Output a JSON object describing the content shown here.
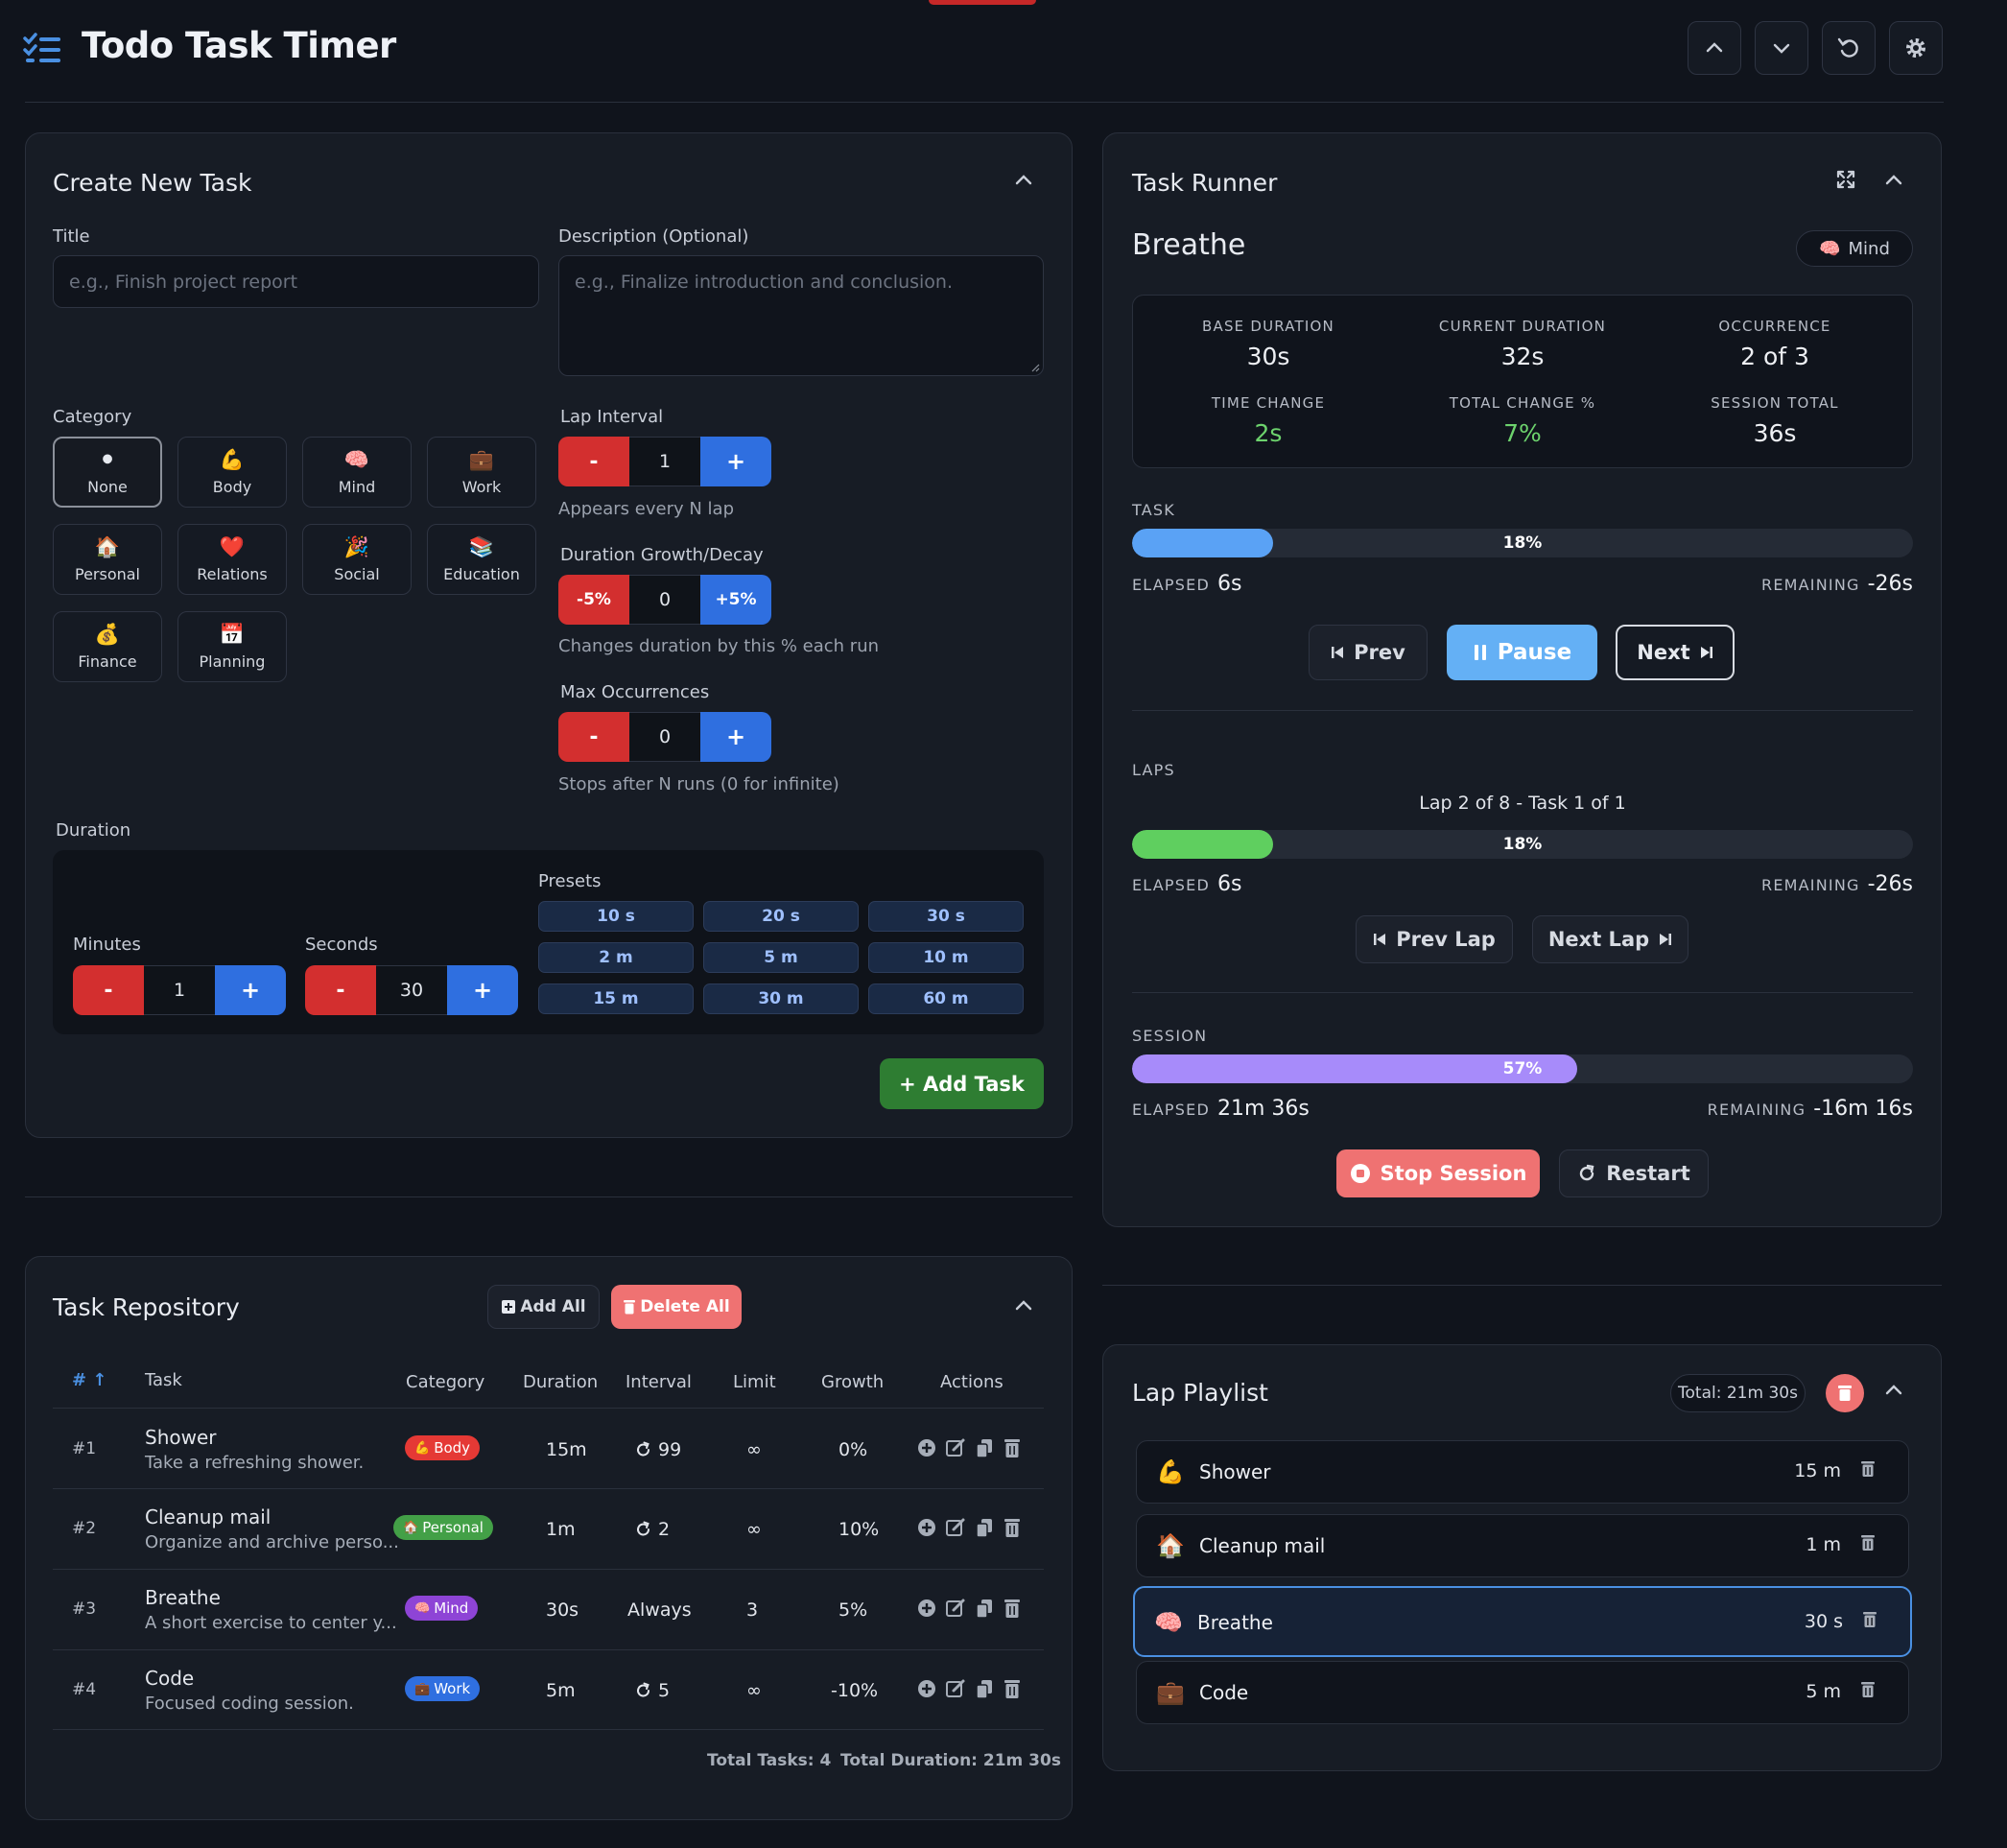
{
  "app": {
    "title": "Todo Task Timer"
  },
  "create": {
    "title": "Create New Task",
    "title_label": "Title",
    "title_placeholder": "e.g., Finish project report",
    "desc_label": "Description (Optional)",
    "desc_placeholder": "e.g., Finalize introduction and conclusion.",
    "category_label": "Category",
    "categories": [
      {
        "label": "None",
        "icon": "⚫"
      },
      {
        "label": "Body",
        "icon": "💪"
      },
      {
        "label": "Mind",
        "icon": "🧠"
      },
      {
        "label": "Work",
        "icon": "💼"
      },
      {
        "label": "Personal",
        "icon": "🏠"
      },
      {
        "label": "Relations",
        "icon": "❤️"
      },
      {
        "label": "Social",
        "icon": "🎉"
      },
      {
        "label": "Education",
        "icon": "📚"
      },
      {
        "label": "Finance",
        "icon": "💰"
      },
      {
        "label": "Planning",
        "icon": "📅"
      }
    ],
    "lap_interval": {
      "label": "Lap Interval",
      "minus": "-",
      "value": "1",
      "plus": "+",
      "hint": "Appears every N lap"
    },
    "growth": {
      "label": "Duration Growth/Decay",
      "minus": "-5%",
      "value": "0",
      "plus": "+5%",
      "hint": "Changes duration by this % each run"
    },
    "max_occ": {
      "label": "Max Occurrences",
      "minus": "-",
      "value": "0",
      "plus": "+",
      "hint": "Stops after N runs (0 for infinite)"
    },
    "duration_label": "Duration",
    "minutes": {
      "label": "Minutes",
      "minus": "-",
      "value": "1",
      "plus": "+"
    },
    "seconds": {
      "label": "Seconds",
      "minus": "-",
      "value": "30",
      "plus": "+"
    },
    "presets_label": "Presets",
    "presets": [
      "10 s",
      "20 s",
      "30 s",
      "2 m",
      "5 m",
      "10 m",
      "15 m",
      "30 m",
      "60 m"
    ],
    "add_button": "+ Add Task"
  },
  "runner": {
    "title": "Task Runner",
    "task_name": "Breathe",
    "category_badge": "Mind",
    "category_icon": "🧠",
    "stats": [
      {
        "label": "BASE DURATION",
        "value": "30s"
      },
      {
        "label": "CURRENT DURATION",
        "value": "32s"
      },
      {
        "label": "OCCURRENCE",
        "value": "2 of 3"
      },
      {
        "label": "TIME CHANGE",
        "value": "2s"
      },
      {
        "label": "TOTAL CHANGE %",
        "value": "7%"
      },
      {
        "label": "SESSION TOTAL",
        "value": "36s"
      }
    ],
    "task_section": {
      "label": "TASK",
      "percent_text": "18%",
      "percent": 18,
      "elapsed_label": "ELAPSED",
      "elapsed": "6s",
      "remaining_label": "REMAINING",
      "remaining": "-26s"
    },
    "prev": "Prev",
    "pause": "Pause",
    "next": "Next",
    "laps_section": {
      "label": "LAPS",
      "summary": "Lap 2 of 8 - Task 1 of 1",
      "percent_text": "18%",
      "percent": 18,
      "elapsed_label": "ELAPSED",
      "elapsed": "6s",
      "remaining_label": "REMAINING",
      "remaining": "-26s"
    },
    "prev_lap": "Prev Lap",
    "next_lap": "Next Lap",
    "session_section": {
      "label": "SESSION",
      "percent_text": "57%",
      "percent": 57,
      "elapsed_label": "ELAPSED",
      "elapsed": "21m 36s",
      "remaining_label": "REMAINING",
      "remaining": "-16m 16s"
    },
    "stop": "Stop Session",
    "restart": "Restart",
    "colors": {
      "task": "#5aa2f5",
      "laps": "#5fcf5f",
      "session": "#a78bfa"
    }
  },
  "repo": {
    "title": "Task Repository",
    "add_all": "Add All",
    "delete_all": "Delete All",
    "headers": [
      "#",
      "Task",
      "Category",
      "Duration",
      "Interval",
      "Limit",
      "Growth",
      "Actions"
    ],
    "rows": [
      {
        "num": "#1",
        "name": "Shower",
        "desc": "Take a refreshing shower.",
        "cat": "Body",
        "cat_icon": "💪",
        "cat_color": "#e53935",
        "duration": "15m",
        "interval": "99",
        "interval_icon": true,
        "limit": "∞",
        "growth": "0%"
      },
      {
        "num": "#2",
        "name": "Cleanup mail",
        "desc": "Organize and archive perso...",
        "cat": "Personal",
        "cat_icon": "🏠",
        "cat_color": "#43a047",
        "duration": "1m",
        "interval": "2",
        "interval_icon": true,
        "limit": "∞",
        "growth": "10%"
      },
      {
        "num": "#3",
        "name": "Breathe",
        "desc": "A short exercise to center y...",
        "cat": "Mind",
        "cat_icon": "🧠",
        "cat_color": "#8e44d6",
        "duration": "30s",
        "interval": "Always",
        "interval_icon": false,
        "limit": "3",
        "growth": "5%"
      },
      {
        "num": "#4",
        "name": "Code",
        "desc": "Focused coding session.",
        "cat": "Work",
        "cat_icon": "💼",
        "cat_color": "#2f6fe0",
        "duration": "5m",
        "interval": "5",
        "interval_icon": true,
        "limit": "∞",
        "growth": "-10%"
      }
    ],
    "total_tasks": "Total Tasks: 4",
    "total_duration": "Total Duration: 21m 30s"
  },
  "playlist": {
    "title": "Lap Playlist",
    "total": "Total: 21m 30s",
    "items": [
      {
        "icon": "💪",
        "name": "Shower",
        "dur": "15 m"
      },
      {
        "icon": "🏠",
        "name": "Cleanup mail",
        "dur": "1 m"
      },
      {
        "icon": "🧠",
        "name": "Breathe",
        "dur": "30 s"
      },
      {
        "icon": "💼",
        "name": "Code",
        "dur": "5 m"
      }
    ]
  }
}
